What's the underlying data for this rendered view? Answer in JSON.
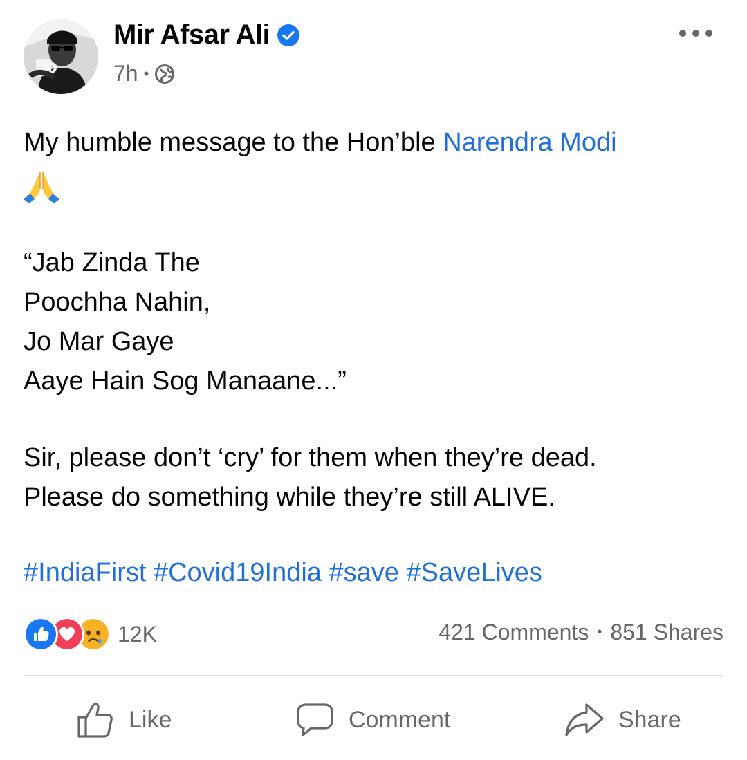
{
  "post": {
    "author": "Mir Afsar Ali",
    "time": "7h",
    "text_prefix": "My humble message to the Hon’ble ",
    "mention": "Narendra Modi",
    "emoji": "folded-hands",
    "quote_lines": [
      "“Jab Zinda The",
      "Poochha Nahin,",
      "Jo Mar Gaye",
      "Aaye Hain Sog Manaane...”"
    ],
    "plea_lines": [
      "Sir, please don’t ‘cry’ for them when they’re dead.",
      "Please do something while they’re still ALIVE."
    ],
    "hashtags": [
      "#IndiaFirst",
      "#Covid19India",
      "#save",
      "#SaveLives"
    ]
  },
  "engagement": {
    "reaction_count": "12K",
    "reactions": [
      "like",
      "love",
      "sad"
    ],
    "comments": "421 Comments",
    "shares": "851 Shares"
  },
  "actions": {
    "like_label": "Like",
    "comment_label": "Comment",
    "share_label": "Share"
  },
  "colors": {
    "link_blue": "#216fdb",
    "meta_gray": "#65676b",
    "like_blue": "#1877f2",
    "love_red": "#f33e58",
    "sad_yellow": "#f7b125"
  }
}
